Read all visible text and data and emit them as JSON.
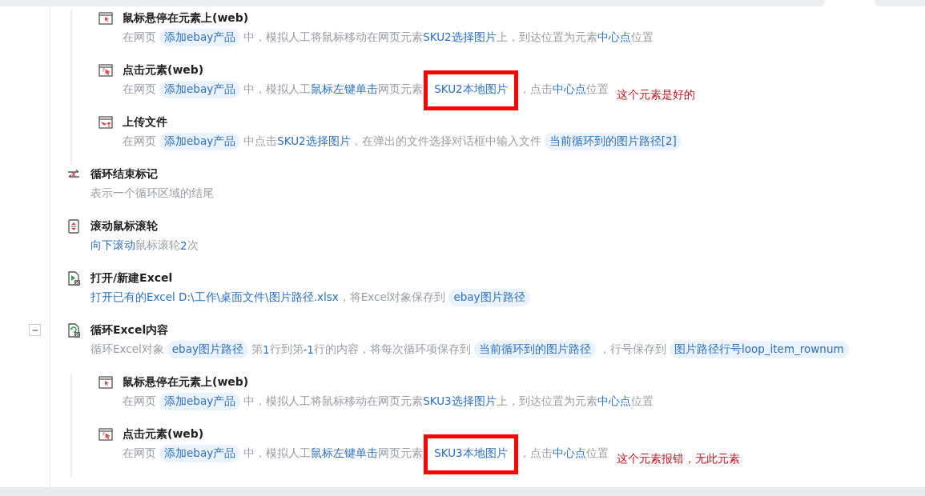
{
  "steps": [
    {
      "kind": "group",
      "children": [
        {
          "kind": "hover",
          "title": "鼠标悬停在元素上(web)",
          "description": [
            {
              "kind": "plain",
              "text": "在网页"
            },
            {
              "kind": "chip",
              "text": "添加ebay产品"
            },
            {
              "kind": "plain",
              "text": "中，模拟人工将鼠标移动在网页元素"
            },
            {
              "kind": "link",
              "text": "SKU2选择图片"
            },
            {
              "kind": "plain",
              "text": "上，到达位置为元素"
            },
            {
              "kind": "link",
              "text": "中心点"
            },
            {
              "kind": "plain",
              "text": "位置"
            }
          ]
        },
        {
          "kind": "click",
          "title": "点击元素(web)",
          "note": "这个元素是好的",
          "description": [
            {
              "kind": "plain",
              "text": "在网页"
            },
            {
              "kind": "chip",
              "text": "添加ebay产品"
            },
            {
              "kind": "plain",
              "text": "中，模拟人工"
            },
            {
              "kind": "link",
              "text": "鼠标左键单击"
            },
            {
              "kind": "plain",
              "text": "网页元素"
            },
            {
              "kind": "link",
              "text": "SKU2本地图片",
              "marked": true
            },
            {
              "kind": "plain",
              "text": "，点击"
            },
            {
              "kind": "link",
              "text": "中心点"
            },
            {
              "kind": "plain",
              "text": "位置"
            }
          ]
        },
        {
          "kind": "upload",
          "title": "上传文件",
          "description": [
            {
              "kind": "plain",
              "text": "在网页"
            },
            {
              "kind": "chip",
              "text": "添加ebay产品"
            },
            {
              "kind": "plain",
              "text": "中点击"
            },
            {
              "kind": "link",
              "text": "SKU2选择图片"
            },
            {
              "kind": "plain",
              "text": "，在弹出的文件选择对话框中输入文件"
            },
            {
              "kind": "chip",
              "text": "当前循环到的图片路径[2]"
            }
          ]
        }
      ]
    },
    {
      "kind": "loop-end",
      "title": "循环结束标记",
      "description": [
        {
          "kind": "plain",
          "text": "表示一个循环区域的结尾"
        }
      ]
    },
    {
      "kind": "scroll",
      "title": "滚动鼠标滚轮",
      "description": [
        {
          "kind": "link",
          "text": "向下滚动"
        },
        {
          "kind": "plain",
          "text": "鼠标滚轮"
        },
        {
          "kind": "link",
          "text": "2"
        },
        {
          "kind": "plain",
          "text": "次"
        }
      ]
    },
    {
      "kind": "excel-open",
      "title": "打开/新建Excel",
      "description": [
        {
          "kind": "link",
          "text": "打开已有的Excel D:\\工作\\桌面文件\\图片路径.xlsx"
        },
        {
          "kind": "plain",
          "text": "，将Excel对象保存到"
        },
        {
          "kind": "chip",
          "text": "ebay图片路径"
        }
      ]
    },
    {
      "kind": "excel-loop",
      "title": "循环Excel内容",
      "expanded": true,
      "description": [
        {
          "kind": "plain",
          "text": "循环Excel对象"
        },
        {
          "kind": "chip",
          "text": "ebay图片路径"
        },
        {
          "kind": "plain",
          "text": "第"
        },
        {
          "kind": "link",
          "text": "1"
        },
        {
          "kind": "plain",
          "text": "行到第"
        },
        {
          "kind": "link",
          "text": "-1"
        },
        {
          "kind": "plain",
          "text": "行的内容，将每次循环项保存到"
        },
        {
          "kind": "chip",
          "text": "当前循环到的图片路径"
        },
        {
          "kind": "plain",
          "text": "，行号保存到"
        },
        {
          "kind": "chip",
          "text": "图片路径行号loop_item_rownum"
        }
      ],
      "children": [
        {
          "kind": "hover",
          "title": "鼠标悬停在元素上(web)",
          "description": [
            {
              "kind": "plain",
              "text": "在网页"
            },
            {
              "kind": "chip",
              "text": "添加ebay产品"
            },
            {
              "kind": "plain",
              "text": "中，模拟人工将鼠标移动在网页元素"
            },
            {
              "kind": "link",
              "text": "SKU3选择图片"
            },
            {
              "kind": "plain",
              "text": "上，到达位置为元素"
            },
            {
              "kind": "link",
              "text": "中心点"
            },
            {
              "kind": "plain",
              "text": "位置"
            }
          ]
        },
        {
          "kind": "click",
          "title": "点击元素(web)",
          "note": "这个元素报错，无此元素",
          "description": [
            {
              "kind": "plain",
              "text": "在网页"
            },
            {
              "kind": "chip",
              "text": "添加ebay产品"
            },
            {
              "kind": "plain",
              "text": "中，模拟人工"
            },
            {
              "kind": "link",
              "text": "鼠标左键单击"
            },
            {
              "kind": "plain",
              "text": "网页元素"
            },
            {
              "kind": "link",
              "text": "SKU3本地图片",
              "marked": true
            },
            {
              "kind": "plain",
              "text": "，点击"
            },
            {
              "kind": "link",
              "text": "中心点"
            },
            {
              "kind": "plain",
              "text": "位置"
            }
          ]
        }
      ]
    }
  ]
}
